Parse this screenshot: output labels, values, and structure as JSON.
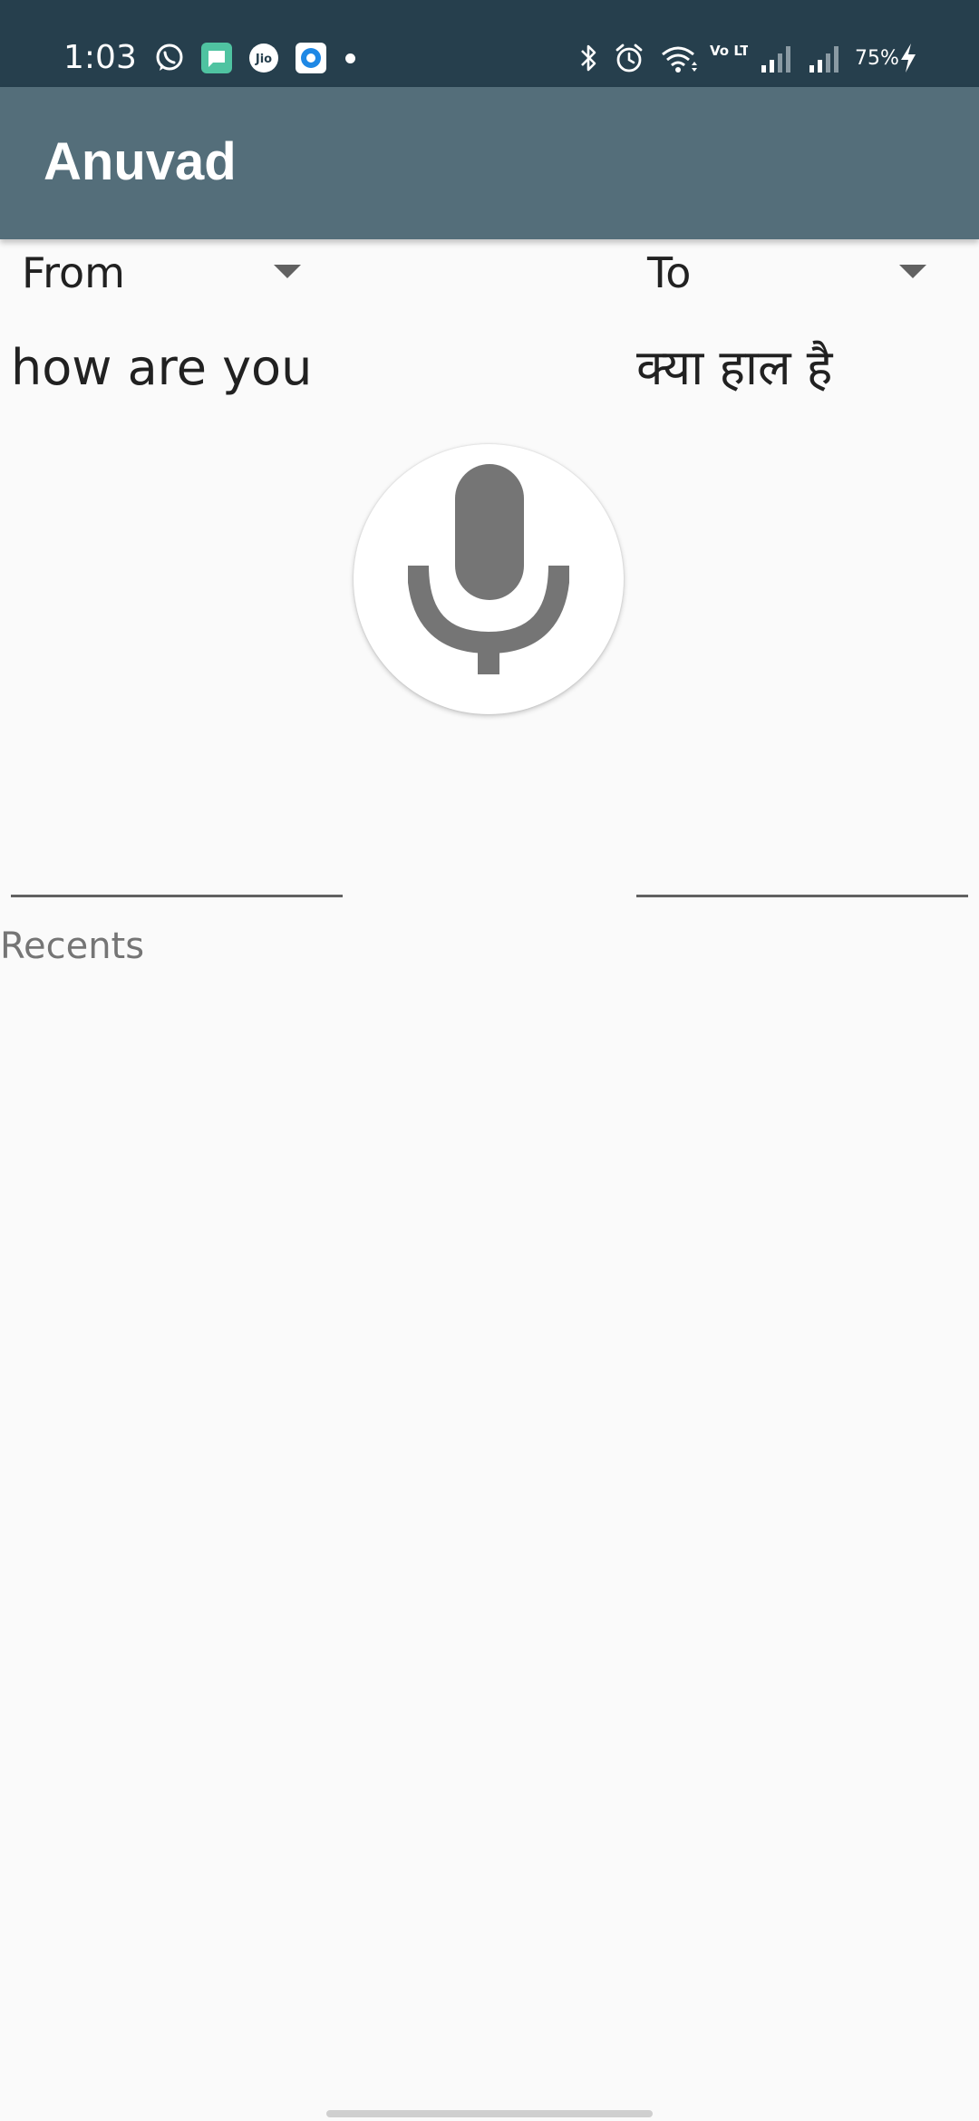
{
  "status_bar": {
    "time": "1:03",
    "battery": "75%",
    "background_color": "#263f4d",
    "left_icons": [
      "whatsapp-icon",
      "messages-icon",
      "jio-icon",
      "browser-icon",
      "notification-dot-icon"
    ],
    "right_icons": [
      "bluetooth-icon",
      "alarm-icon",
      "wifi-icon",
      "volte-icon",
      "signal-icon",
      "signal-icon",
      "battery-charging-icon"
    ],
    "volte_text": "Vo LTE"
  },
  "app_bar": {
    "title": "Anuvad",
    "background_color": "#546e7a"
  },
  "from_spinner": {
    "label": "From"
  },
  "to_spinner": {
    "label": "To"
  },
  "source_text": {
    "value": "how are you"
  },
  "target_text": {
    "value": "क्या हाल है"
  },
  "mic_button": {
    "icon": "microphone-icon",
    "icon_color": "#757575"
  },
  "recents": {
    "label": "Recents"
  }
}
